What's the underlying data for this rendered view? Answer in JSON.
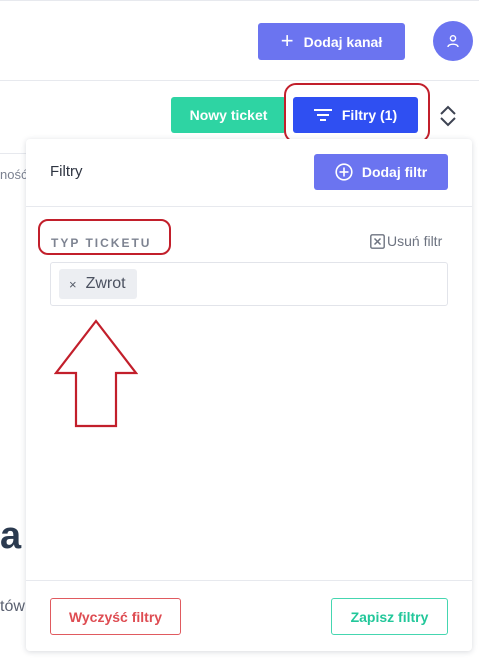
{
  "header": {
    "add_channel_label": "Dodaj kanał"
  },
  "toolbar": {
    "new_ticket_label": "Nowy ticket",
    "filters_label": "Filtry (1)"
  },
  "background": {
    "fragment_left": "ność",
    "fragment_big": "a",
    "fragment_bottom": "tów"
  },
  "filter_panel": {
    "title": "Filtry",
    "add_filter_label": "Dodaj filtr",
    "filter_type_label": "TYP TICKETU",
    "remove_filter_label": "Usuń filtr",
    "tags": [
      {
        "label": "Zwrot",
        "remove_symbol": "×"
      }
    ],
    "clear_label": "Wyczyść filtry",
    "save_label": "Zapisz filtry"
  },
  "colors": {
    "primary": "#6b74f0",
    "filters_active": "#2f4ff2",
    "success": "#2ed4a3",
    "danger": "#de4c52",
    "annotation": "#c21f2b"
  }
}
